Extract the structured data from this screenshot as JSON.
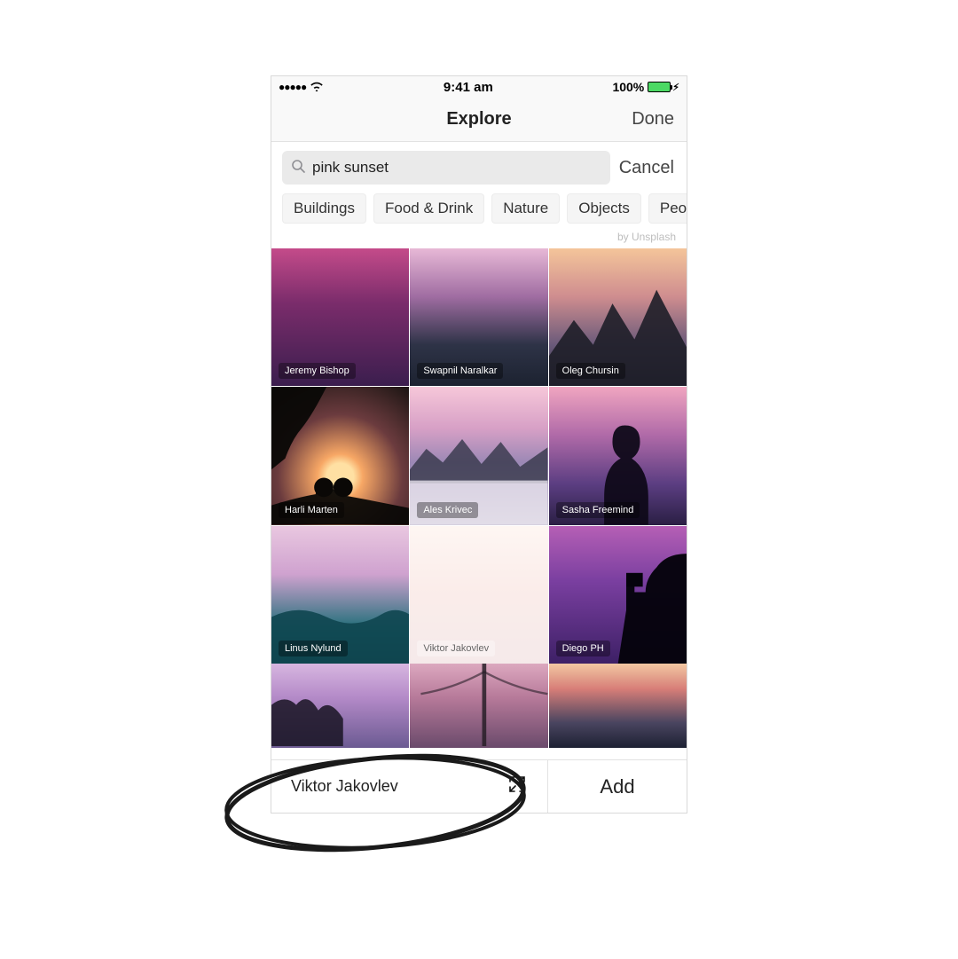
{
  "status": {
    "time": "9:41 am",
    "battery_text": "100%"
  },
  "nav": {
    "title": "Explore",
    "done": "Done"
  },
  "search": {
    "value": "pink sunset",
    "cancel": "Cancel"
  },
  "chips": [
    "Buildings",
    "Food & Drink",
    "Nature",
    "Objects",
    "People"
  ],
  "attribution": "by Unsplash",
  "tiles": [
    {
      "credit": "Jeremy Bishop"
    },
    {
      "credit": "Swapnil Naralkar"
    },
    {
      "credit": "Oleg Chursin"
    },
    {
      "credit": "Harli  Marten"
    },
    {
      "credit": "Ales Krivec"
    },
    {
      "credit": "Sasha  Freemind"
    },
    {
      "credit": "Linus Nylund"
    },
    {
      "credit": "Viktor Jakovlev",
      "selected": true
    },
    {
      "credit": "Diego PH"
    },
    {
      "credit": ""
    },
    {
      "credit": ""
    },
    {
      "credit": ""
    }
  ],
  "bottom": {
    "selected_name": "Viktor Jakovlev",
    "add": "Add"
  }
}
